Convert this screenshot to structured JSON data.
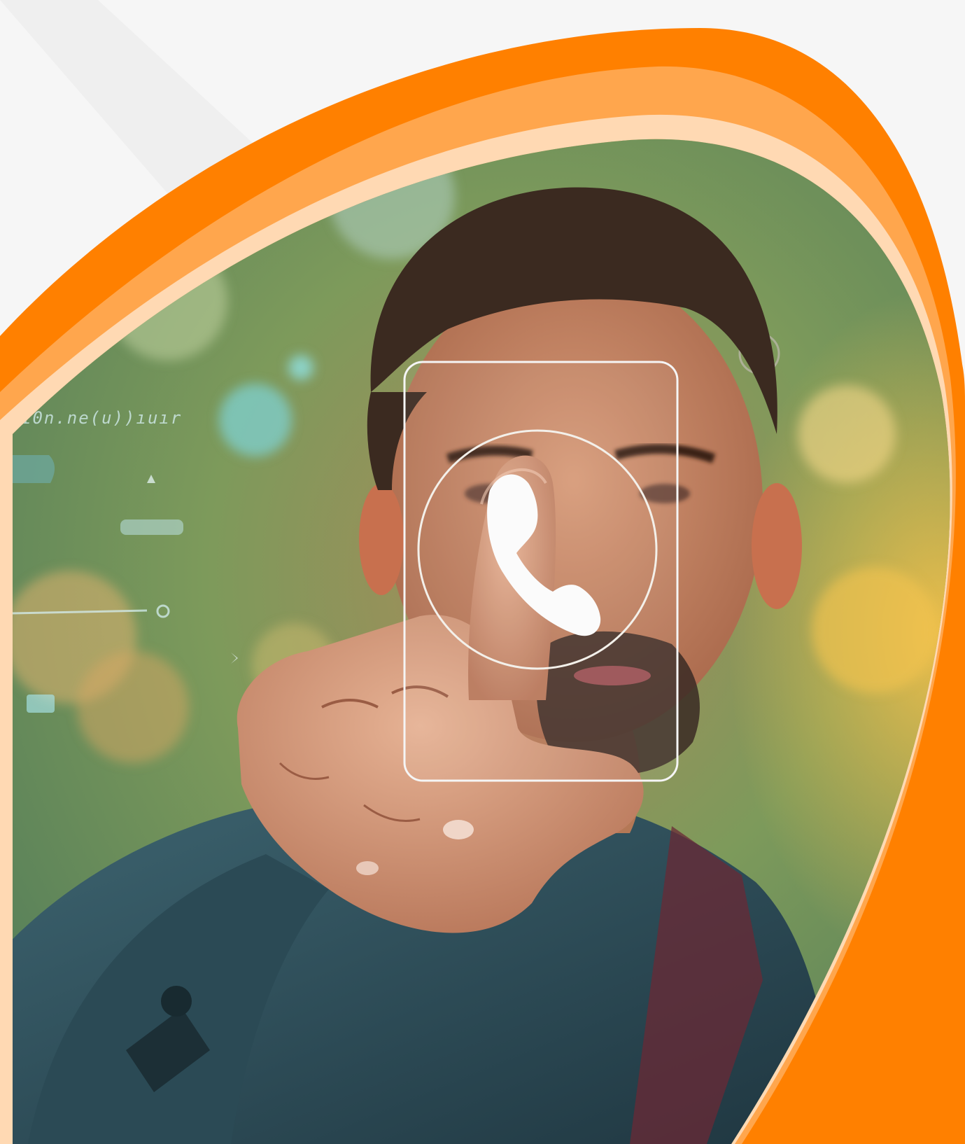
{
  "image": {
    "subject": "man-pressing-virtual-call-button",
    "icons": [
      "phone-icon"
    ],
    "colors": {
      "frame_orange_dark": "#ff8000",
      "frame_orange_mid": "#ffa64d",
      "frame_orange_light": "#ffd9b3",
      "background": "#f6f6f6",
      "bokeh_green": "#6f9a5a",
      "bokeh_yellow": "#e8b54a",
      "jacket_blue": "#2f4a55",
      "skin": "#c58a6a",
      "hair": "#3b2a20"
    }
  }
}
